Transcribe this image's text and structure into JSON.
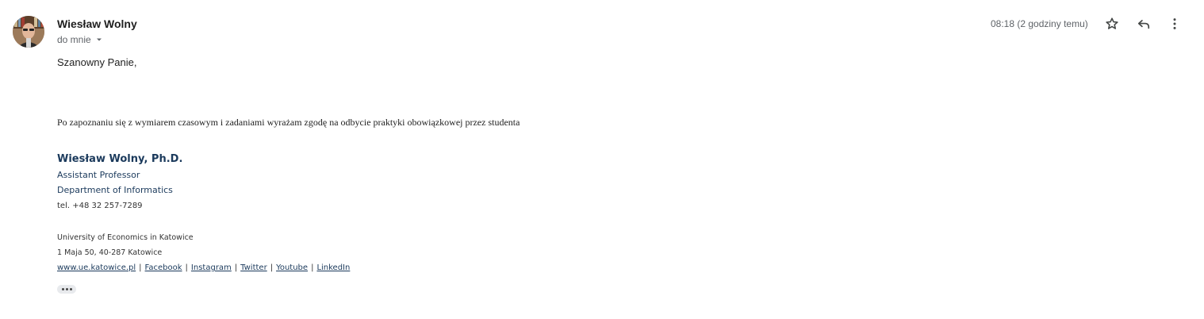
{
  "email": {
    "sender_name": "Wiesław Wolny",
    "recipient": "do mnie",
    "timestamp": "08:18 (2 godziny temu)",
    "icons": {
      "avatar": "avatar",
      "recipient_caret": "chevron-down-icon",
      "star": "star-icon",
      "reply": "reply-icon",
      "more": "more-vert-icon",
      "show_trimmed": "ellipsis-icon"
    },
    "body": {
      "greeting": "Szanowny Panie,",
      "text": "Po zapoznaniu się z wymiarem czasowym i zadaniami wyrażam zgodę na odbycie praktyki obowiązkowej przez studenta"
    },
    "signature": {
      "name": "Wiesław Wolny, Ph.D.",
      "title": "Assistant Professor",
      "department": "Department of Informatics",
      "tel": "tel. +48 32 257-7289",
      "university": "University of Economics in Katowice",
      "address": "1 Maja 50, 40-287 Katowice",
      "links": [
        {
          "label": "www.ue.katowice.pl"
        },
        {
          "label": "Facebook"
        },
        {
          "label": "Instagram"
        },
        {
          "label": "Twitter"
        },
        {
          "label": "Youtube"
        },
        {
          "label": "LinkedIn"
        }
      ],
      "separator": "|"
    },
    "colors": {
      "signature_accent": "#1b3a5c",
      "meta_text": "#5f6368"
    }
  }
}
